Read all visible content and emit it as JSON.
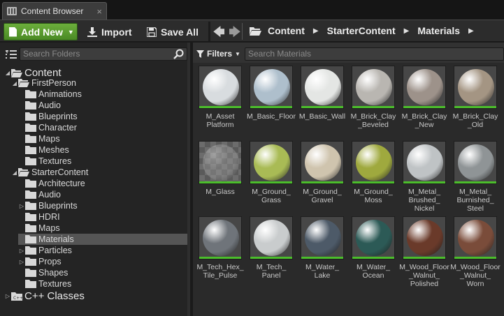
{
  "tab": {
    "title": "Content Browser",
    "close": "×"
  },
  "toolbar": {
    "add_new_label": "Add New",
    "import_label": "Import",
    "save_all_label": "Save All",
    "back_arrow": "🡄",
    "forward_arrow": "🡆",
    "breadcrumbs": [
      "Content",
      "StarterContent",
      "Materials"
    ]
  },
  "folders": {
    "search_placeholder": "Search Folders",
    "tree": [
      {
        "label": "Content",
        "level": 0,
        "expanded": true,
        "big": true
      },
      {
        "label": "FirstPerson",
        "level": 1,
        "expanded": true
      },
      {
        "label": "Animations",
        "level": 2
      },
      {
        "label": "Audio",
        "level": 2
      },
      {
        "label": "Blueprints",
        "level": 2
      },
      {
        "label": "Character",
        "level": 2
      },
      {
        "label": "Maps",
        "level": 2
      },
      {
        "label": "Meshes",
        "level": 2
      },
      {
        "label": "Textures",
        "level": 2
      },
      {
        "label": "StarterContent",
        "level": 1,
        "expanded": true
      },
      {
        "label": "Architecture",
        "level": 2
      },
      {
        "label": "Audio",
        "level": 2
      },
      {
        "label": "Blueprints",
        "level": 2,
        "collapsed": true
      },
      {
        "label": "HDRI",
        "level": 2
      },
      {
        "label": "Maps",
        "level": 2
      },
      {
        "label": "Materials",
        "level": 2,
        "selected": true
      },
      {
        "label": "Particles",
        "level": 2,
        "collapsed": true
      },
      {
        "label": "Props",
        "level": 2,
        "collapsed": true
      },
      {
        "label": "Shapes",
        "level": 2
      },
      {
        "label": "Textures",
        "level": 2
      },
      {
        "label": "C++ Classes",
        "level": 0,
        "collapsed": true,
        "big": true,
        "cpp": true
      }
    ]
  },
  "assets": {
    "filters_label": "Filters",
    "search_placeholder": "Search Materials",
    "items": [
      {
        "label": "M_Asset\nPlatform",
        "color": "#d8dcdf"
      },
      {
        "label": "M_Basic_Floor",
        "color": "#aebfcc"
      },
      {
        "label": "M_Basic_Wall",
        "color": "#e4e6e4"
      },
      {
        "label": "M_Brick_Clay\n_Beveled",
        "color": "#b9b6b1"
      },
      {
        "label": "M_Brick_Clay\n_New",
        "color": "#9d928a"
      },
      {
        "label": "M_Brick_Clay\n_Old",
        "color": "#a49583"
      },
      {
        "label": "M_Glass",
        "color": "#a8a8a8"
      },
      {
        "label": "M_Ground_\nGrass",
        "color": "#a9bb55"
      },
      {
        "label": "M_Ground_\nGravel",
        "color": "#cfc4ae"
      },
      {
        "label": "M_Ground_\nMoss",
        "color": "#9fa93e"
      },
      {
        "label": "M_Metal_\nBrushed_\nNickel",
        "color": "#bfc3c5"
      },
      {
        "label": "M_Metal_\nBurnished_\nSteel",
        "color": "#8f9496"
      },
      {
        "label": "M_Tech_Hex_\nTile_Pulse",
        "color": "#6f747a"
      },
      {
        "label": "M_Tech_\nPanel",
        "color": "#c9cccd"
      },
      {
        "label": "M_Water_\nLake",
        "color": "#4d5a68"
      },
      {
        "label": "M_Water_\nOcean",
        "color": "#2c5a56"
      },
      {
        "label": "M_Wood_Floor\n_Walnut_\nPolished",
        "color": "#6a3a2a"
      },
      {
        "label": "M_Wood_Floor\n_Walnut_\nWorn",
        "color": "#7a4c3a"
      }
    ]
  }
}
